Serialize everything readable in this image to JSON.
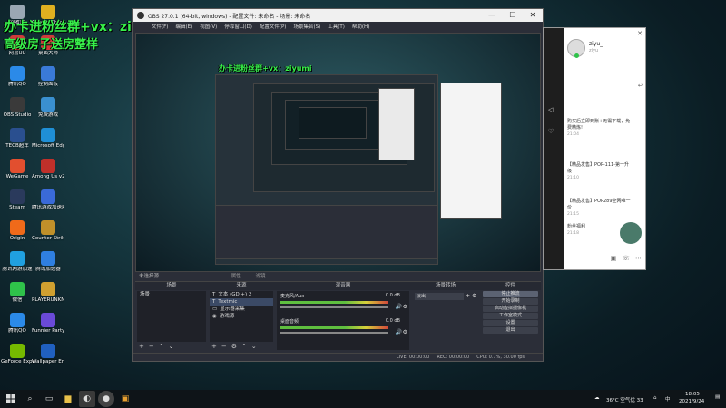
{
  "overlay": {
    "line1": "办卡进粉丝群+vx：ziyumi",
    "line2": "高级房子送房整样"
  },
  "desktop": {
    "icons": [
      {
        "label": "回收站",
        "color": "#9aa7b4"
      },
      {
        "label": "网易UU",
        "color": "#d23a3a"
      },
      {
        "label": "腾讯QQ",
        "color": "#2b8ae8"
      },
      {
        "label": "OBS Studio",
        "color": "#3a3a3a"
      },
      {
        "label": "TECB超车",
        "color": "#2a4f8f"
      },
      {
        "label": "WeGame",
        "color": "#e24f2f"
      },
      {
        "label": "Steam",
        "color": "#2a3a5c"
      },
      {
        "label": "Origin",
        "color": "#f06a1a"
      },
      {
        "label": "腾讯网游加速",
        "color": "#20a0e0"
      },
      {
        "label": "微信",
        "color": "#2fc24a"
      },
      {
        "label": "腾讯QQ",
        "color": "#2b8ae8"
      },
      {
        "label": "GeForce Experience",
        "color": "#76b900"
      },
      {
        "label": "Google Chrome",
        "color": "#e0b020"
      },
      {
        "label": "桌面大师",
        "color": "#d03a3a"
      },
      {
        "label": "控制面板",
        "color": "#3a7ad8"
      },
      {
        "label": "免费游戏",
        "color": "#3a90d0"
      },
      {
        "label": "Microsoft Edge",
        "color": "#1f8fd6"
      },
      {
        "label": "Among Us v2020",
        "color": "#c0302a"
      },
      {
        "label": "腾讯游戏加速器",
        "color": "#3a6ad8"
      },
      {
        "label": "Counter-Strike Global",
        "color": "#c0902a"
      },
      {
        "label": "腾讯加速器",
        "color": "#2f7fe0"
      },
      {
        "label": "PLAYERUNKNOWN BATTLEG",
        "color": "#d0a030"
      },
      {
        "label": "Funnier Party",
        "color": "#6a4ad8"
      },
      {
        "label": "Wallpaper Engine",
        "color": "#2060c0"
      }
    ]
  },
  "obs": {
    "title": "OBS 27.0.1 (64-bit, windows) - 配置文件: 未命名 - 场景: 未命名",
    "window_buttons": [
      "—",
      "☐",
      "✕"
    ],
    "menu": [
      "文件(F)",
      "编辑(E)",
      "视图(V)",
      "停靠窗口(D)",
      "配置文件(P)",
      "场景集合(S)",
      "工具(T)",
      "帮助(H)"
    ],
    "preview_label": "来源预览",
    "no_source": "未选择源",
    "props_btn": "属性",
    "filters_btn": "滤镜",
    "docks": {
      "scenes": {
        "title": "场景",
        "items": [
          "场景"
        ]
      },
      "sources": {
        "title": "来源",
        "items": [
          "文本 (GDI+) 2",
          "Textmic",
          "显示器采集",
          "游戏源"
        ]
      },
      "mixer": {
        "title": "混音器",
        "channels": [
          {
            "name": "麦克风/Aux",
            "db": "0.0 dB"
          },
          {
            "name": "桌面音频",
            "db": "0.0 dB"
          }
        ]
      },
      "transitions": {
        "title": "场景转场",
        "value": "淡出",
        "duration": "300 ms"
      },
      "controls": {
        "title": "控件",
        "buttons": [
          "停止推流",
          "开始录制",
          "启动虚拟摄像机",
          "工作室模式",
          "设置",
          "退出"
        ]
      }
    },
    "status": {
      "live": "LIVE: 00:00:00",
      "rec": "REC: 00:00:00",
      "cpu": "CPU: 0.7%, 30.00 fps"
    }
  },
  "chat": {
    "username": "ziyu_",
    "sub": "ziyu",
    "messages": [
      {
        "text": "购买后立即到账+无需下载，免费精炼!",
        "time": "21:04"
      },
      {
        "text": "【精品发售】POP-111-第一升级",
        "time": "21:10"
      },
      {
        "text": "【精品发售】POP289全网唯一价",
        "time": "21:15"
      },
      {
        "text": "粉丝福利",
        "time": "21:18"
      }
    ]
  },
  "taskbar": {
    "start_icon": "windows-icon",
    "search_icon": "search-icon",
    "weather": "36°C 空气优 33",
    "ime": "中",
    "time": "18:05",
    "date": "2021/9/24"
  }
}
